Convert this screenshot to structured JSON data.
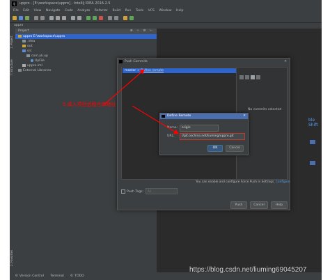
{
  "window": {
    "title": "uppro - [E:\\workspace\\uppro] - IntelliJ IDEA 2016.2.5"
  },
  "menu": [
    "File",
    "Edit",
    "View",
    "Navigate",
    "Code",
    "Analyze",
    "Refactor",
    "Build",
    "Run",
    "Tools",
    "VCS",
    "Window",
    "Help"
  ],
  "navbar": {
    "crumb": "uppro"
  },
  "side_tabs": {
    "project": "1: Project",
    "structure": "7: Structure",
    "favorites": "2: Favorites"
  },
  "project_panel": {
    "header": "Project",
    "tree": [
      {
        "label": "uppro  E:\\workspace\\uppro",
        "indent": 1,
        "selected": true
      },
      {
        "label": ".idea",
        "indent": 2
      },
      {
        "label": "out",
        "indent": 2
      },
      {
        "label": "src",
        "indent": 2
      },
      {
        "label": "com.yk.up",
        "indent": 3
      },
      {
        "label": "UpFile",
        "indent": 4
      },
      {
        "label": "uppro.iml",
        "indent": 2
      },
      {
        "label": "External Libraries",
        "indent": 1
      }
    ]
  },
  "editor_hint": "ble Shift",
  "status": {
    "version_control": "9: Version Control",
    "terminal": "Terminal",
    "todo": "6: TODO"
  },
  "push_dialog": {
    "title": "Push Commits",
    "branch": "master",
    "arrow": "→",
    "define_remote_link": "Define remote",
    "no_commits": "No commits selected",
    "force_push_note": "You can enable and configure Force Push in Settings.",
    "configure_link": "Configure",
    "push_tags_label": "Push Tags:",
    "push_tags_value": "All",
    "push_button": "Push",
    "cancel_button": "Cancel",
    "help_button": "Help"
  },
  "define_remote": {
    "title": "Define Remote",
    "name_label": "Name:",
    "name_value": "origin",
    "url_label": "URL:",
    "url_value": "//git.oschina.net/liuming/uppro.git",
    "ok_button": "OK",
    "cancel_button": "Cancel"
  },
  "annotation": {
    "text": "5.填入项目远程仓库地址",
    "color": "#ff0000"
  },
  "watermark": "https://blog.csdn.net/liuming69045207"
}
